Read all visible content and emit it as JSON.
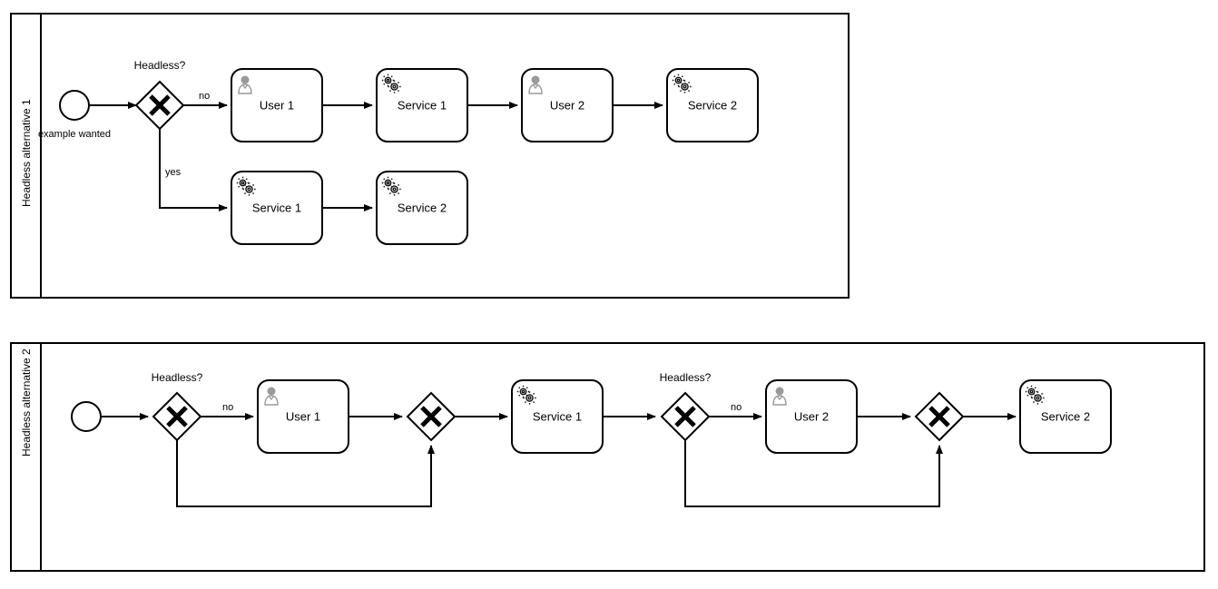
{
  "diagram": {
    "type": "bpmn-process-diagram",
    "background_color": "#ffffff",
    "stroke_color": "#000000",
    "icon_user_color": "#9a9a9a",
    "icon_service_color": "#111111"
  },
  "pools": [
    {
      "id": "pool1",
      "lane_label": "Headless alternative 1",
      "start_event": {
        "label": "example wanted"
      },
      "gateways": [
        {
          "id": "gw1",
          "type": "exclusive",
          "marker": "X",
          "label": "Headless?"
        }
      ],
      "flow_labels": {
        "no": "no",
        "yes": "yes"
      },
      "tasks_top": [
        {
          "id": "t1",
          "type": "user",
          "icon": "user-icon",
          "label": "User 1"
        },
        {
          "id": "t2",
          "type": "service",
          "icon": "gears-icon",
          "label": "Service 1"
        },
        {
          "id": "t3",
          "type": "user",
          "icon": "user-icon",
          "label": "User 2"
        },
        {
          "id": "t4",
          "type": "service",
          "icon": "gears-icon",
          "label": "Service 2"
        }
      ],
      "tasks_bottom": [
        {
          "id": "t5",
          "type": "service",
          "icon": "gears-icon",
          "label": "Service 1"
        },
        {
          "id": "t6",
          "type": "service",
          "icon": "gears-icon",
          "label": "Service 2"
        }
      ]
    },
    {
      "id": "pool2",
      "lane_label": "Headless alternative 2",
      "start_event": {
        "label": ""
      },
      "gateways": [
        {
          "id": "gw2a",
          "type": "exclusive",
          "marker": "X",
          "label": "Headless?"
        },
        {
          "id": "gw2b",
          "type": "exclusive",
          "marker": "X",
          "label": ""
        },
        {
          "id": "gw2c",
          "type": "exclusive",
          "marker": "X",
          "label": "Headless?"
        },
        {
          "id": "gw2d",
          "type": "exclusive",
          "marker": "X",
          "label": ""
        }
      ],
      "flow_labels": {
        "no_1": "no",
        "no_2": "no"
      },
      "tasks": [
        {
          "id": "u1",
          "type": "user",
          "icon": "user-icon",
          "label": "User 1"
        },
        {
          "id": "s1",
          "type": "service",
          "icon": "gears-icon",
          "label": "Service 1"
        },
        {
          "id": "u2",
          "type": "user",
          "icon": "user-icon",
          "label": "User 2"
        },
        {
          "id": "s2",
          "type": "service",
          "icon": "gears-icon",
          "label": "Service 2"
        }
      ]
    }
  ]
}
